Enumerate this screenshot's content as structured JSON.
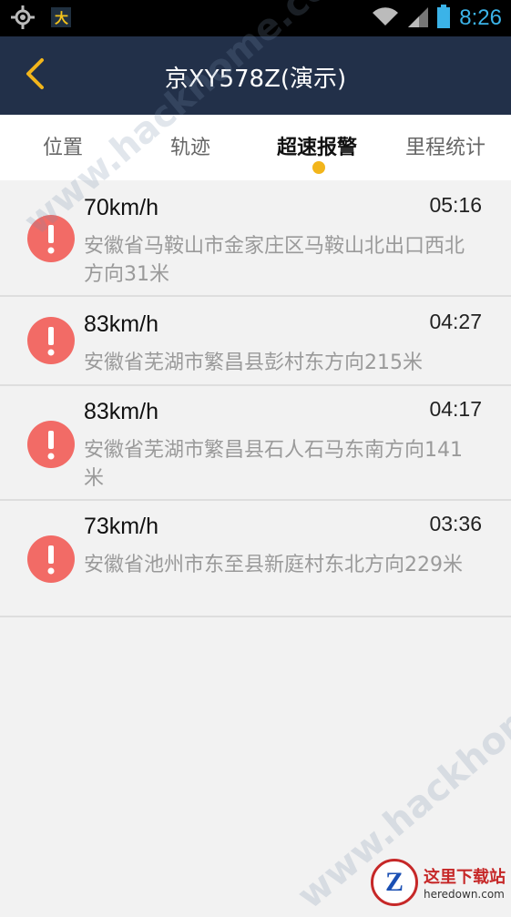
{
  "status_bar": {
    "time": "8:26",
    "icons": [
      "gps-icon",
      "app-notification-icon",
      "wifi-icon",
      "signal-icon",
      "battery-icon"
    ]
  },
  "header": {
    "title": "京XY578Z(演示)",
    "back_icon": "chevron-left-icon"
  },
  "tabs": [
    {
      "label": "位置",
      "active": false
    },
    {
      "label": "轨迹",
      "active": false
    },
    {
      "label": "超速报警",
      "active": true
    },
    {
      "label": "里程统计",
      "active": false
    }
  ],
  "alerts": [
    {
      "speed": "70km/h",
      "time": "05:16",
      "address": "安徽省马鞍山市金家庄区马鞍山北出口西北方向31米"
    },
    {
      "speed": "83km/h",
      "time": "04:27",
      "address": "安徽省芜湖市繁昌县彭村东方向215米"
    },
    {
      "speed": "83km/h",
      "time": "04:17",
      "address": "安徽省芜湖市繁昌县石人石马东南方向141米"
    },
    {
      "speed": "73km/h",
      "time": "03:36",
      "address": "安徽省池州市东至县新庭村东北方向229米"
    }
  ],
  "watermark": {
    "text": "www.hackhome.com",
    "corner_logo_mark": "Z",
    "corner_logo_cn": "这里下载站",
    "corner_logo_en": "heredown.com"
  },
  "colors": {
    "header_bg": "#223049",
    "accent": "#f2b51b",
    "alert_red": "#f26b66",
    "status_blue": "#3bb3e8"
  }
}
